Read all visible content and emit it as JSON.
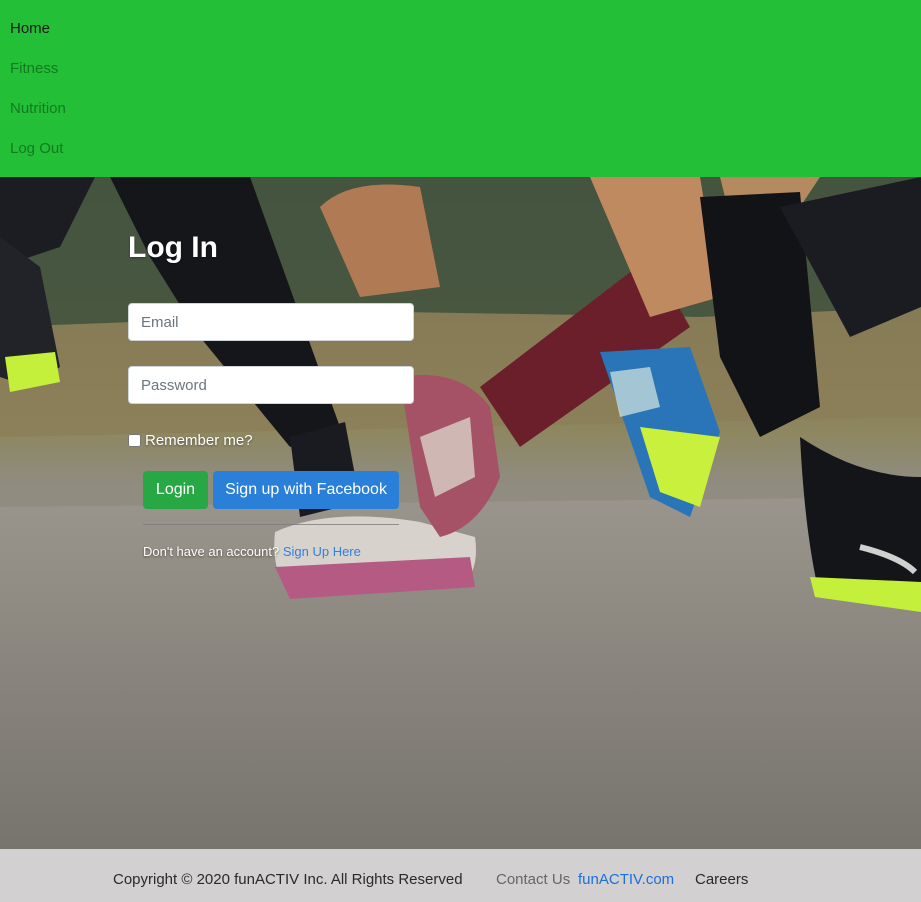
{
  "nav": {
    "items": [
      {
        "label": "Home",
        "active": true
      },
      {
        "label": "Fitness"
      },
      {
        "label": "Nutrition"
      },
      {
        "label": "Log Out"
      }
    ],
    "background_color": "#22bf37"
  },
  "login": {
    "title": "Log In",
    "email_placeholder": "Email",
    "password_placeholder": "Password",
    "remember_label": "Remember me?",
    "login_button": "Login",
    "facebook_button": "Sign up with Facebook",
    "no_account_text": "Don't have an account?",
    "signup_link": "Sign Up Here"
  },
  "footer": {
    "copyright": "Copyright © 2020 funACTIV Inc. All Rights Reserved",
    "contact_label": "Contact Us",
    "contact_link": "funACTIV.com",
    "careers": "Careers"
  },
  "colors": {
    "login_button": "#28a745",
    "facebook_button": "#2a7fd8",
    "link": "#1b6fe0",
    "footer_background": "#d2d0d1"
  }
}
